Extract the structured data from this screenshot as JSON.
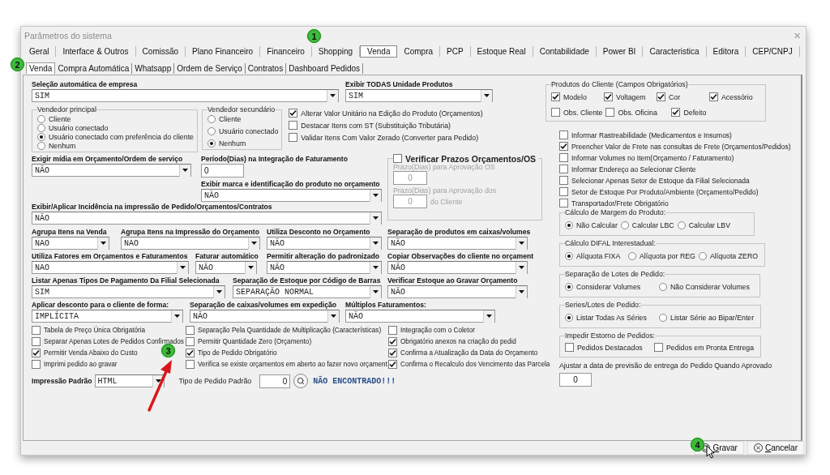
{
  "window": {
    "title": "Parâmetros do sistema",
    "close": "×"
  },
  "tabs": [
    {
      "label": "Geral",
      "selected": false
    },
    {
      "label": "Interface & Outros",
      "selected": false
    },
    {
      "label": "Comissão",
      "selected": false
    },
    {
      "label": "Plano Financeiro",
      "selected": false
    },
    {
      "label": "Financeiro",
      "selected": false
    },
    {
      "label": "Shopping",
      "selected": false
    },
    {
      "label": "Venda",
      "selected": true
    },
    {
      "label": "Compra",
      "selected": false
    },
    {
      "label": "PCP",
      "selected": false
    },
    {
      "label": "Estoque Real",
      "selected": false
    },
    {
      "label": "Contabilidade",
      "selected": false
    },
    {
      "label": "Power BI",
      "selected": false
    },
    {
      "label": "Caracteristica",
      "selected": false
    },
    {
      "label": "Editora",
      "selected": false
    },
    {
      "label": "CEP/CNPJ",
      "selected": false
    }
  ],
  "subtabs": [
    {
      "label": "Venda",
      "selected": true
    },
    {
      "label": "Compra Automática",
      "selected": false
    },
    {
      "label": "Whatsapp",
      "selected": false
    },
    {
      "label": "Ordem de Serviço",
      "selected": false
    },
    {
      "label": "Contratos",
      "selected": false
    },
    {
      "label": "Dashboard Pedidos",
      "selected": false
    }
  ],
  "top_selects": [
    {
      "label": "Seleção automática de empresa",
      "value": "SIM"
    },
    {
      "label": "Exibir TODAS Unidade Produtos",
      "value": "SIM"
    }
  ],
  "vendedor_principal": {
    "legend": "Vendedor principal",
    "options": [
      {
        "label": "Cliente",
        "selected": false
      },
      {
        "label": "Usuário conectado",
        "selected": false
      },
      {
        "label": "Usuário conectado com preferência do cliente",
        "selected": true
      },
      {
        "label": "Nenhum",
        "selected": false
      }
    ]
  },
  "vendedor_secundario": {
    "legend": "Vendedor secundário",
    "options": [
      {
        "label": "Cliente",
        "selected": false
      },
      {
        "label": "Usuário conectado",
        "selected": false
      },
      {
        "label": "Nenhum",
        "selected": true
      }
    ]
  },
  "sales_checks": [
    {
      "label": "Alterar Valor Unitário na Edição do Produto (Orçamentos)",
      "checked": true
    },
    {
      "label": "Destacar Itens com ST (Substituição Tributária)",
      "checked": false
    },
    {
      "label": "Validar Itens Com Valor Zerado (Converter para Pedido)",
      "checked": false
    }
  ],
  "exigir_midia": {
    "label": "Exigir mídia em Orçamento/Ordem de serviço",
    "value": "NÃO"
  },
  "periodo": {
    "label": "Período(Dias) na Integração de Faturamento",
    "value": "0"
  },
  "exibir_marca": {
    "label": "Exibir marca e identificação do produto no orçamento",
    "value": "NÃO"
  },
  "incidencia": {
    "label": "Exibir/Aplicar Incidência na impressão de Pedido/Orçamentos/Contratos",
    "value": "NÃO"
  },
  "verificar_prazos": {
    "label": "Verificar Prazos Orçamentos/OS",
    "checked": false,
    "fields": [
      {
        "label": "Prazo(Dias) para Aprovação OS",
        "value": "0"
      },
      {
        "label": "Prazo(Dias) para Aprovação dos",
        "value": "0",
        "suffix": "do Cliente"
      }
    ]
  },
  "select_rows": [
    [
      {
        "label": "Agrupa Itens na Venda",
        "value": "NAO"
      },
      {
        "label": "Agrupa Itens na Impressão do Orçamento",
        "value": "NAO"
      },
      {
        "label": "Utiliza Desconto no Orçamento",
        "value": "NÃO"
      },
      {
        "label": "Separação de produtos em caixas/volumes",
        "value": "NÃO"
      }
    ],
    [
      {
        "label": "Utiliza Fatores em Orçamentos e Faturamentos",
        "value": "NAO"
      },
      {
        "label": "Faturar automático",
        "value": "NÃO"
      },
      {
        "label": "Permitir alteração do padronizado",
        "value": "NÃO"
      },
      {
        "label": "Copiar Observações do cliente no orçament",
        "value": "NÃO"
      }
    ],
    [
      {
        "label": "Listar Apenas Tipos De Pagamento Da Filial Selecionada",
        "value": "SIM"
      },
      {
        "label": "Separação de Estoque por Código de Barras",
        "value": "SEPARAÇÃO NORMAL"
      },
      {
        "label": "Verificar Estoque ao Gravar Orçamento",
        "value": "NÃO"
      }
    ],
    [
      {
        "label": "Aplicar desconto para o cliente de forma:",
        "value": "IMPLÍCITA"
      },
      {
        "label": "Separação de caixas/volumes em expedição",
        "value": "NÃO"
      },
      {
        "label": "Múltiplos Faturamentos:",
        "value": "NÃO"
      }
    ]
  ],
  "check_columns": [
    [
      {
        "label": "Tabela de Preço Única Obrigatória",
        "checked": false
      },
      {
        "label": "Separar Apenas Lotes de Pedidos Confirmados",
        "checked": false
      },
      {
        "label": "Permitir Venda Abaixo do Custo",
        "checked": true
      },
      {
        "label": "Imprimi pedido ao gravar",
        "checked": false
      }
    ],
    [
      {
        "label": "Separação Pela Quantidade de Multiplicação (Características)",
        "checked": false
      },
      {
        "label": "Permitir Quantidade Zero (Orçamento)",
        "checked": false
      },
      {
        "label": "Tipo de Pedido Obrigatório",
        "checked": true
      },
      {
        "label": "Verifica se existe orçamentos em aberto ao fazer novo orçament",
        "checked": false
      }
    ],
    [
      {
        "label": "Integração com o Coletor",
        "checked": false
      },
      {
        "label": "Obrigatório anexos na criação do pedid",
        "checked": true
      },
      {
        "label": "Confirma a Atualização da Data do Orçamento",
        "checked": true
      },
      {
        "label": "Confirma o Recalculo dos Vencimento das Parcela",
        "checked": true
      }
    ]
  ],
  "impressao_padrao": {
    "label": "Impressão Padrão",
    "value": "HTML"
  },
  "tipo_pedido": {
    "label": "Tipo de Pedido Padrão",
    "value": "0",
    "status": "NÃO ENCONTRADO!!!"
  },
  "produtos_cliente": {
    "legend": "Produtos do Cliente (Campos Obrigatórios)",
    "items": [
      {
        "label": "Modelo",
        "checked": true
      },
      {
        "label": "Voltagem",
        "checked": true
      },
      {
        "label": "Cor",
        "checked": true
      },
      {
        "label": "Acessório",
        "checked": true
      },
      {
        "label": "Obs. Cliente",
        "checked": false
      },
      {
        "label": "Obs. Oficina",
        "checked": false
      },
      {
        "label": "Defeito",
        "checked": true
      }
    ]
  },
  "right_checks": [
    {
      "label": "Informar Rastreabilidade (Medicamentos e Insumos)",
      "checked": false
    },
    {
      "label": "Preencher Valor de Frete nas consultas de Frete (Orçamentos/Pedidos)",
      "checked": true
    },
    {
      "label": "Informar Volumes no Item(Orçamento / Faturamento)",
      "checked": false
    },
    {
      "label": "Informar Endereço ao Selecionar Cliente",
      "checked": false
    },
    {
      "label": "Selecionar Apenas Setor de Estoque da Filial Selecionada",
      "checked": false
    },
    {
      "label": "Setor de Estoque Por Produto/Ambiente (Orçamento/Pedido)",
      "checked": false
    },
    {
      "label": "Transportador/Frete Obrigatório",
      "checked": false
    }
  ],
  "radio_groups": [
    {
      "legend": "Cálculo de Margem do Produto:",
      "options": [
        {
          "label": "Não Calcular",
          "selected": true
        },
        {
          "label": "Calcular LBC",
          "selected": false
        },
        {
          "label": "Calcular LBV",
          "selected": false
        }
      ]
    },
    {
      "legend": "Cálculo DIFAL Interestadual:",
      "options": [
        {
          "label": "Alíquota FIXA",
          "selected": true
        },
        {
          "label": "Alíquota por REG",
          "selected": false
        },
        {
          "label": "Alíquota ZERO",
          "selected": false
        }
      ]
    },
    {
      "legend": "Separação de Lotes de Pedido:",
      "options": [
        {
          "label": "Considerar Volumes",
          "selected": true
        },
        {
          "label": "Não Considerar Volumes",
          "selected": false
        }
      ]
    },
    {
      "legend": "Series/Lotes de Pedido:",
      "options": [
        {
          "label": "Listar Todas As Séries",
          "selected": true
        },
        {
          "label": "Listar Série ao Bipar/Enter",
          "selected": false
        }
      ]
    }
  ],
  "impedir_estorno": {
    "legend": "Impedir Estorno de Pedidos:",
    "items": [
      {
        "label": "Pedidos Destacados",
        "checked": false
      },
      {
        "label": "Pedidos em Pronta Entrega",
        "checked": false
      }
    ]
  },
  "ajustar": {
    "label": "Ajustar a data de previsão de entrega do Pedido Quando Aprovado",
    "value": "0"
  },
  "buttons": [
    {
      "label": "Gravar",
      "kind": "save"
    },
    {
      "label": "Cancelar",
      "kind": "cancel"
    }
  ],
  "annotations": [
    "1",
    "2",
    "3",
    "4"
  ]
}
